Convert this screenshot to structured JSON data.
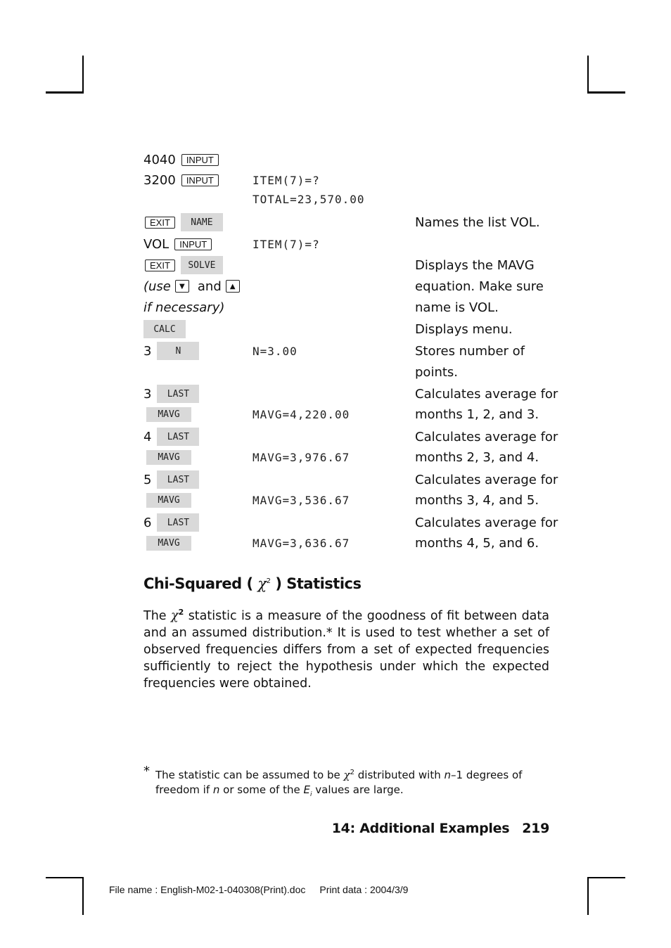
{
  "steps": [
    {
      "keys": [
        {
          "type": "text",
          "value": "4040"
        },
        {
          "type": "key",
          "value": "INPUT"
        }
      ],
      "display": "",
      "description": ""
    },
    {
      "keys": [
        {
          "type": "text",
          "value": "3200"
        },
        {
          "type": "key",
          "value": "INPUT"
        }
      ],
      "display": "ITEM(7)=?",
      "description": ""
    },
    {
      "keys": [],
      "display": "TOTAL=23,570.00",
      "description": ""
    },
    {
      "keys": [
        {
          "type": "key",
          "value": "EXIT"
        },
        {
          "type": "soft",
          "value": "NAME"
        }
      ],
      "display": "",
      "description": "Names the list VOL."
    },
    {
      "keys": [
        {
          "type": "text",
          "value": "VOL"
        },
        {
          "type": "key",
          "value": "INPUT"
        }
      ],
      "display": "ITEM(7)=?",
      "description": ""
    },
    {
      "keys": [
        {
          "type": "key",
          "value": "EXIT"
        },
        {
          "type": "soft",
          "value": "SOLVE"
        }
      ],
      "display": "",
      "description": "Displays the MAVG"
    },
    {
      "keys": [
        {
          "type": "italic",
          "value": "(use"
        },
        {
          "type": "arrow",
          "value": "▼"
        },
        {
          "type": "text",
          "value": "and"
        },
        {
          "type": "arrow",
          "value": "▲"
        }
      ],
      "display": "",
      "description": "equation. Make sure"
    },
    {
      "keys": [
        {
          "type": "italic",
          "value": "if necessary)"
        }
      ],
      "display": "",
      "description": "name is VOL."
    },
    {
      "keys": [
        {
          "type": "soft",
          "value": "CALC"
        }
      ],
      "display": "",
      "description": "Displays menu."
    },
    {
      "keys": [
        {
          "type": "text",
          "value": "3"
        },
        {
          "type": "soft",
          "value": "N"
        }
      ],
      "display": "N=3.00",
      "description": "Stores number of"
    },
    {
      "keys": [],
      "display": "",
      "description": "points."
    },
    {
      "keys": [
        {
          "type": "text",
          "value": "3"
        },
        {
          "type": "soft",
          "value": "LAST"
        }
      ],
      "display": "",
      "description": "Calculates average for"
    },
    {
      "keys": [
        {
          "type": "softsmall",
          "value": "MAVG"
        }
      ],
      "display": "MAVG=4,220.00",
      "description": "months 1, 2, and 3."
    },
    {
      "keys": [
        {
          "type": "text",
          "value": "4"
        },
        {
          "type": "soft",
          "value": "LAST"
        }
      ],
      "display": "",
      "description": "Calculates average for"
    },
    {
      "keys": [
        {
          "type": "softsmall",
          "value": "MAVG"
        }
      ],
      "display": "MAVG=3,976.67",
      "description": "months 2, 3, and 4."
    },
    {
      "keys": [
        {
          "type": "text",
          "value": "5"
        },
        {
          "type": "soft",
          "value": "LAST"
        }
      ],
      "display": "",
      "description": "Calculates average for"
    },
    {
      "keys": [
        {
          "type": "softsmall",
          "value": "MAVG"
        }
      ],
      "display": "MAVG=3,536.67",
      "description": "months 3, 4, and 5."
    },
    {
      "keys": [
        {
          "type": "text",
          "value": "6"
        },
        {
          "type": "soft",
          "value": "LAST"
        }
      ],
      "display": "",
      "description": "Calculates average for"
    },
    {
      "keys": [
        {
          "type": "softsmall",
          "value": "MAVG"
        }
      ],
      "display": "MAVG=3,636.67",
      "description": "months 4, 5, and 6."
    }
  ],
  "section": {
    "title_before": "Chi-Squared (",
    "chi": "χ",
    "sup": "2",
    "title_after": ") Statistics",
    "body_before": "The",
    "body_chi": "χ",
    "body_sup": "2",
    "body_after": " statistic is a measure of the goodness of fit between data and an assumed distribution.* It is used to test whether a set of observed frequencies differs from a set of expected frequencies sufficiently to reject the hypothesis under which the expected frequencies were obtained."
  },
  "footnote": {
    "star": "*",
    "part1": "The statistic can be assumed to be ",
    "chi": "χ",
    "sup": "2",
    "part2": " distributed with ",
    "n1": "n",
    "part3": "–1 degrees of freedom if ",
    "n2": "n",
    "part4": " or some of the ",
    "e": "E",
    "esub": "i",
    "part5": " values are large."
  },
  "page_footer": {
    "chapter": "14: Additional Examples",
    "page": "219"
  },
  "file_info": {
    "file_name": "File name : English-M02-1-040308(Print).doc",
    "print_data": "Print data : 2004/3/9"
  }
}
